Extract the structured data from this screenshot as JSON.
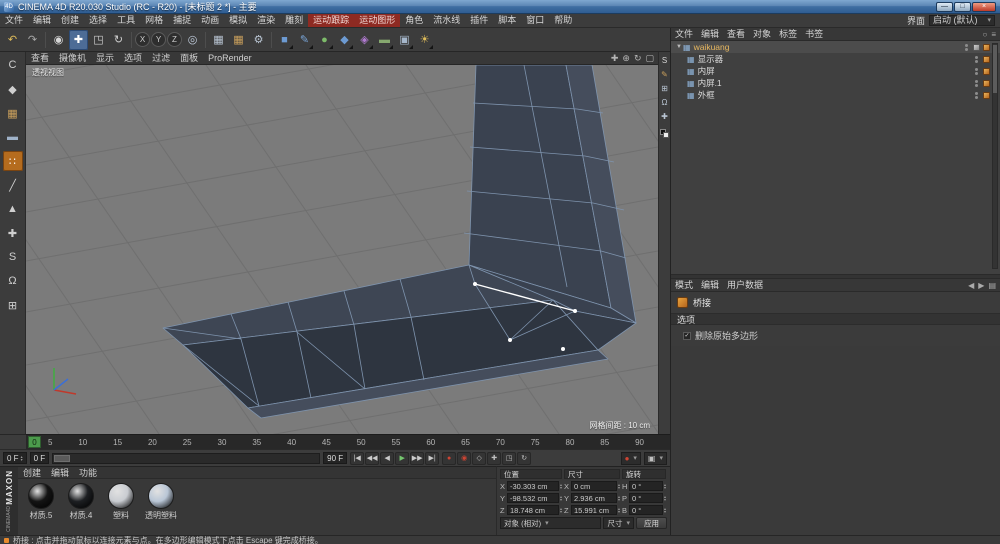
{
  "titlebar": {
    "app_icon": "4D",
    "title": "CINEMA 4D R20.030 Studio (RC - R20) - [未标题 2 *] - 主要",
    "minimize": "—",
    "maximize": "□",
    "close": "×"
  },
  "menubar": {
    "items": [
      {
        "label": "文件"
      },
      {
        "label": "编辑"
      },
      {
        "label": "创建"
      },
      {
        "label": "选择"
      },
      {
        "label": "工具"
      },
      {
        "label": "网格"
      },
      {
        "label": "捕捉"
      },
      {
        "label": "动画"
      },
      {
        "label": "模拟"
      },
      {
        "label": "渲染"
      },
      {
        "label": "雕刻"
      },
      {
        "label": "运动跟踪",
        "cls": "red"
      },
      {
        "label": "运动图形",
        "cls": "red"
      },
      {
        "label": "角色"
      },
      {
        "label": "流水线"
      },
      {
        "label": "插件"
      },
      {
        "label": "脚本"
      },
      {
        "label": "窗口"
      },
      {
        "label": "帮助"
      }
    ],
    "interface_label": "界面",
    "layout_value": "启动 (默认)"
  },
  "toolbar": {
    "items": [
      {
        "name": "undo-button",
        "glyph": "↶",
        "fg": "#e0bd5a"
      },
      {
        "name": "redo-button",
        "glyph": "↷",
        "fg": "#a8a8a8"
      },
      {
        "name": "toolbar-separator",
        "cls": "sep"
      },
      {
        "name": "live-selection-tool",
        "glyph": "◉",
        "fg": "#d8d8d8"
      },
      {
        "name": "move-tool",
        "glyph": "✚",
        "fg": "#ffffff",
        "cls": "active"
      },
      {
        "name": "scale-tool",
        "glyph": "◳",
        "fg": "#d0d0d0"
      },
      {
        "name": "rotate-tool",
        "glyph": "↻",
        "fg": "#d0d0d0"
      },
      {
        "name": "toolbar-separator",
        "cls": "sep"
      },
      {
        "name": "x-axis-lock-button",
        "glyph": "X",
        "cls": "round"
      },
      {
        "name": "y-axis-lock-button",
        "glyph": "Y",
        "cls": "round"
      },
      {
        "name": "z-axis-lock-button",
        "glyph": "Z",
        "cls": "round"
      },
      {
        "name": "coordinate-system-button",
        "glyph": "◎",
        "fg": "#c2cede"
      },
      {
        "name": "toolbar-separator",
        "cls": "sep"
      },
      {
        "name": "render-view-button",
        "glyph": "▦",
        "fg": "#b9c5d3"
      },
      {
        "name": "render-picture-viewer-button",
        "glyph": "▦",
        "fg": "#caa05c"
      },
      {
        "name": "render-settings-button",
        "glyph": "⚙",
        "fg": "#b9c5d3"
      },
      {
        "name": "toolbar-separator",
        "cls": "sep"
      },
      {
        "name": "primitive-cube-menu",
        "glyph": "■",
        "fg": "#6d9bd3",
        "dd": true
      },
      {
        "name": "spline-pen-menu",
        "glyph": "✎",
        "fg": "#79a5d8",
        "dd": true
      },
      {
        "name": "generators-menu",
        "glyph": "●",
        "fg": "#7dbb6a",
        "dd": true
      },
      {
        "name": "array-menu",
        "glyph": "◆",
        "fg": "#6d9bd3",
        "dd": true
      },
      {
        "name": "deformer-menu",
        "glyph": "◈",
        "fg": "#b07ad0",
        "dd": true
      },
      {
        "name": "environment-menu",
        "glyph": "▬",
        "fg": "#86a86f",
        "dd": true
      },
      {
        "name": "camera-menu",
        "glyph": "▣",
        "fg": "#a5b6ca",
        "dd": true
      },
      {
        "name": "light-menu",
        "glyph": "☀",
        "fg": "#e0bd5a",
        "dd": true
      }
    ]
  },
  "left_toolbar": {
    "items": [
      {
        "name": "make-editable-button",
        "glyph": "C",
        "fg": "#cfcfcf"
      },
      {
        "name": "model-mode-button",
        "glyph": "◆",
        "fg": "#cfcfcf"
      },
      {
        "name": "texture-mode-button",
        "glyph": "▦",
        "fg": "#caa05c"
      },
      {
        "name": "workplane-mode-button",
        "glyph": "▬",
        "fg": "#9fb2c8"
      },
      {
        "name": "points-mode-button",
        "glyph": "∷",
        "fg": "#ffffff",
        "cls": "active"
      },
      {
        "name": "edges-mode-button",
        "glyph": "╱",
        "fg": "#cfcfcf"
      },
      {
        "name": "polygons-mode-button",
        "glyph": "▲",
        "fg": "#cfcfcf"
      },
      {
        "name": "enable-axis-button",
        "glyph": "✚",
        "fg": "#cfcfcf"
      },
      {
        "name": "snap-toggle-button",
        "glyph": "S",
        "fg": "#cfcfcf"
      },
      {
        "name": "magnet-snap-button",
        "glyph": "Ω",
        "fg": "#cfcfcf"
      },
      {
        "name": "workplane-snap-button",
        "glyph": "⊞",
        "fg": "#cfcfcf"
      }
    ]
  },
  "viewport": {
    "menus": [
      "查看",
      "摄像机",
      "显示",
      "选项",
      "过滤",
      "面板",
      "ProRender"
    ],
    "nav_icons": [
      {
        "name": "pan-view-icon",
        "glyph": "✚"
      },
      {
        "name": "zoom-view-icon",
        "glyph": "⊕"
      },
      {
        "name": "rotate-view-icon",
        "glyph": "↻"
      },
      {
        "name": "toggle-view-icon",
        "glyph": "▢"
      }
    ],
    "view_label": "透视视图",
    "grid_label": "网格间距 : 10 cm"
  },
  "dock_strip": {
    "icons": [
      {
        "name": "solo-toggle-icon",
        "glyph": "S",
        "fg": "#d8d8d8"
      },
      {
        "name": "brush-tool-icon",
        "glyph": "✎",
        "fg": "#caa05c"
      },
      {
        "name": "grid-snap-icon",
        "glyph": "⊞",
        "fg": "#b9c5d3"
      },
      {
        "name": "magnet-icon",
        "glyph": "Ω",
        "fg": "#b9c5d3"
      },
      {
        "name": "axis-lock-icon",
        "glyph": "✚",
        "fg": "#b9c5d3"
      }
    ]
  },
  "object_manager": {
    "menus": [
      "文件",
      "编辑",
      "查看",
      "对象",
      "标签",
      "书签"
    ],
    "header_icons": [
      {
        "name": "search-icon",
        "glyph": "○"
      },
      {
        "name": "filter-icon",
        "glyph": "≡"
      }
    ],
    "objects": [
      {
        "name": "waikuang",
        "depth": 0,
        "fg": "#e8b860",
        "cls": "selected",
        "arrow": true,
        "extra_tag": true,
        "icon": "▦",
        "icon_fg": "#8fb3d9"
      },
      {
        "name": "显示器",
        "depth": 1,
        "fg": "#dcdcdc",
        "icon": "▦",
        "icon_fg": "#8fb3d9"
      },
      {
        "name": "内屏",
        "depth": 1,
        "fg": "#dcdcdc",
        "icon": "▦",
        "icon_fg": "#8fb3d9"
      },
      {
        "name": "内屏.1",
        "depth": 1,
        "fg": "#dcdcdc",
        "icon": "▦",
        "icon_fg": "#8fb3d9"
      },
      {
        "name": "外框",
        "depth": 1,
        "fg": "#dcdcdc",
        "icon": "▦",
        "icon_fg": "#8fb3d9"
      }
    ]
  },
  "attributes": {
    "menus": [
      "模式",
      "编辑",
      "用户数据"
    ],
    "header_icons": [
      {
        "name": "history-back-icon",
        "glyph": "◀"
      },
      {
        "name": "history-forward-icon",
        "glyph": "▶"
      },
      {
        "name": "am-options-icon",
        "glyph": "▤"
      }
    ],
    "tool_name": "桥接",
    "section": "选项",
    "options": [
      {
        "label": "删除原始多边形",
        "checked": "✓"
      }
    ]
  },
  "timeline": {
    "marker": "0",
    "ticks": [
      "5",
      "10",
      "15",
      "20",
      "25",
      "30",
      "35",
      "40",
      "45",
      "50",
      "55",
      "60",
      "65",
      "70",
      "75",
      "80",
      "85",
      "90"
    ],
    "current_frame": "0 F",
    "range_start": "0 F",
    "range_end": "90 F",
    "transport": [
      {
        "name": "goto-start-button",
        "glyph": "|◀"
      },
      {
        "name": "prev-key-button",
        "glyph": "◀◀"
      },
      {
        "name": "prev-frame-button",
        "glyph": "◀"
      },
      {
        "name": "play-button",
        "glyph": "▶",
        "fg": "#74c56e"
      },
      {
        "name": "next-frame-button",
        "glyph": "▶▶"
      },
      {
        "name": "goto-end-button",
        "glyph": "▶|"
      }
    ],
    "record_buttons": [
      {
        "name": "record-keyframe-button",
        "glyph": "●",
        "fg": "#cd4433"
      },
      {
        "name": "autokey-button",
        "glyph": "◉",
        "fg": "#cd4433"
      },
      {
        "name": "keyframe-selection-button",
        "glyph": "◇",
        "fg": "#c0c0c0"
      },
      {
        "name": "record-position-button",
        "glyph": "✚",
        "fg": "#c0c0c0"
      },
      {
        "name": "record-scale-button",
        "glyph": "◳",
        "fg": "#c0c0c0"
      },
      {
        "name": "record-rotation-button",
        "glyph": "↻",
        "fg": "#c0c0c0"
      }
    ],
    "dropdowns": [
      {
        "name": "keying-settings-dropdown",
        "glyph": "●",
        "fg": "#cd4433"
      },
      {
        "name": "playback-settings-dropdown",
        "glyph": "▣",
        "fg": "#c0c0c0"
      }
    ]
  },
  "coordinates": {
    "titles": [
      "位置",
      "尺寸",
      "旋转"
    ],
    "rows": [
      {
        "a1": "X",
        "v1": "-30.303 cm",
        "a2": "X",
        "v2": "0 cm",
        "a3": "H",
        "v3": "0 °"
      },
      {
        "a1": "Y",
        "v1": "-98.532 cm",
        "a2": "Y",
        "v2": "2.936 cm",
        "a3": "P",
        "v3": "0 °"
      },
      {
        "a1": "Z",
        "v1": "18.748 cm",
        "a2": "Z",
        "v2": "15.991 cm",
        "a3": "B",
        "v3": "0 °"
      }
    ],
    "transform_mode": "对象 (相对)",
    "size_mode": "尺寸",
    "apply_label": "应用"
  },
  "materials": {
    "menus": [
      "创建",
      "编辑",
      "功能"
    ],
    "items": [
      {
        "name": "材质.5",
        "color": "#141414"
      },
      {
        "name": "材质.4",
        "color": "#1d1f22"
      },
      {
        "name": "塑料",
        "color": "#c9ccd1"
      },
      {
        "name": "透明塑料",
        "color": "#b9c6d6"
      }
    ]
  },
  "brand": {
    "maxon": "MAXON",
    "cinema": "CINEMA4D"
  },
  "statusbar": {
    "text": "桥接 : 点击并拖动鼠标以连接元素与点。在多边形编辑模式下点击 Escape 键完成桥接。"
  }
}
